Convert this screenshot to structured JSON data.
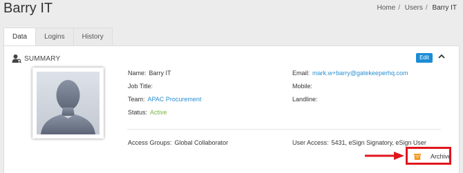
{
  "header": {
    "title": "Barry IT",
    "breadcrumb": [
      "Home",
      "Users",
      "Barry IT"
    ]
  },
  "tabs": [
    {
      "label": "Data",
      "active": true
    },
    {
      "label": "Logins",
      "active": false
    },
    {
      "label": "History",
      "active": false
    }
  ],
  "summary": {
    "title": "SUMMARY",
    "icon": "user-search-icon",
    "edit_label": "Edit",
    "collapse_icon": "chevron-up-icon"
  },
  "profile": {
    "name_label": "Name:",
    "name": "Barry IT",
    "job_title_label": "Job Title:",
    "job_title": "",
    "team_label": "Team:",
    "team": "APAC Procurement",
    "status_label": "Status:",
    "status": "Active",
    "email_label": "Email:",
    "email": "mark.w+barry@gatekeeperhq.com",
    "mobile_label": "Mobile:",
    "mobile": "",
    "landline_label": "Landline:",
    "landline": "",
    "access_groups_label": "Access Groups:",
    "access_groups": "Global Collaborator",
    "user_access_label": "User Access:",
    "user_access": "5431, eSign Signatory, eSign User"
  },
  "actions": {
    "archive_label": "Archive",
    "archive_icon": "archive-box-icon"
  },
  "colors": {
    "link": "#2a8fd0",
    "active_status": "#7cb342",
    "edit_button": "#1b8dd6",
    "archive_icon": "#f39a1e",
    "highlight": "#e0151d"
  }
}
